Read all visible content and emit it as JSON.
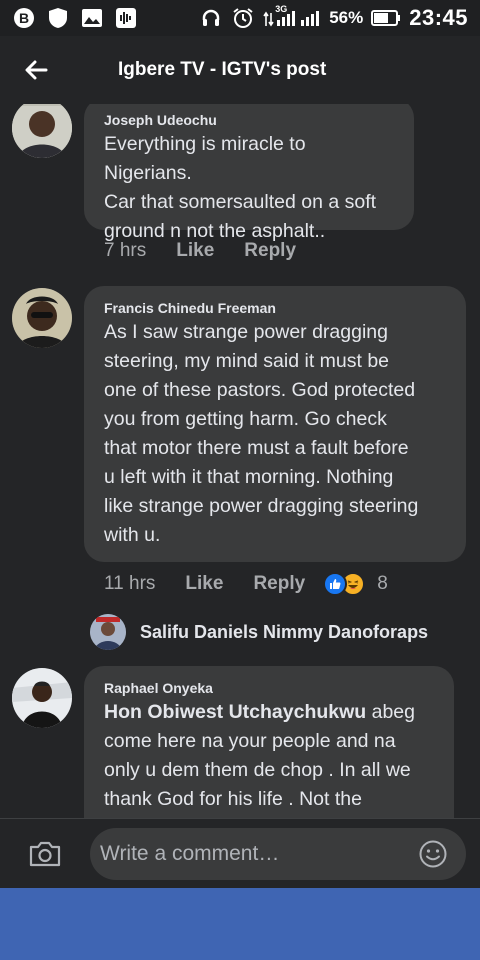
{
  "status_bar": {
    "network": "3G",
    "battery": "56%",
    "time": "23:45"
  },
  "header": {
    "title": "Igbere TV - IGTV's post"
  },
  "comments": [
    {
      "author": "Joseph Udeochu",
      "lines": [
        "Everything is miracle to Nigerians.",
        "Car that somersaulted on a soft",
        "ground n not the asphalt.."
      ],
      "time": "7 hrs",
      "like": "Like",
      "reply": "Reply"
    },
    {
      "author": "Francis Chinedu Freeman",
      "lines": [
        "As I saw strange power dragging",
        "steering, my mind said it must be",
        "one of these pastors. God protected",
        "you from getting harm. Go check",
        "that motor there must a fault before",
        "u left with it that morning. Nothing",
        "like strange power dragging steering",
        "with u."
      ],
      "time": "11 hrs",
      "like": "Like",
      "reply": "Reply",
      "reaction_count": "8",
      "reply_preview": "Salifu Daniels Nimmy Danoforaps"
    },
    {
      "author": "Raphael Onyeka",
      "mention": "Hon Obiwest Utchaychukwu",
      "first_line_rest": " abeg",
      "lines": [
        "come here na your people and na",
        "only u dem them de chop . In all we",
        "thank God for his life . Not the"
      ]
    }
  ],
  "composer": {
    "placeholder": "Write a comment…"
  },
  "colors": {
    "background": "#242527",
    "bubble": "#3a3b3c",
    "navbar": "#3f65b3",
    "like_blue": "#1877f2"
  }
}
